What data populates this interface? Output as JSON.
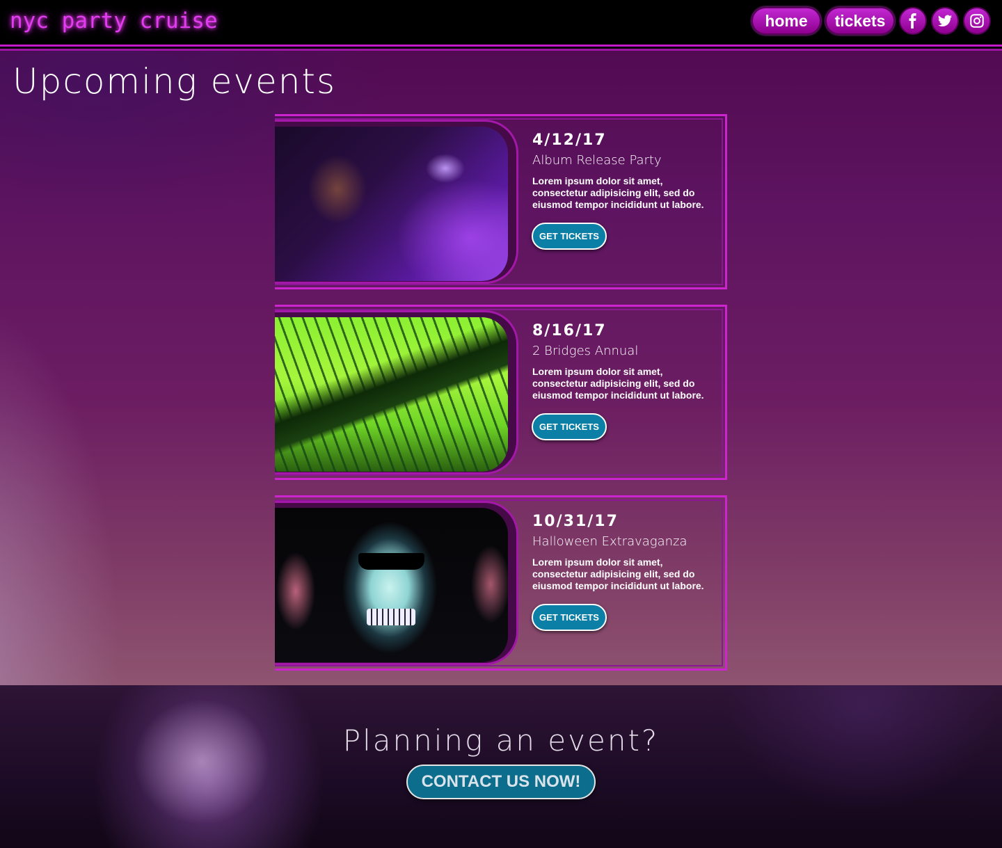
{
  "header": {
    "brand": "nyc party cruise",
    "nav": {
      "home_label": "home",
      "tickets_label": "tickets",
      "social": [
        "facebook-icon",
        "twitter-icon",
        "instagram-icon"
      ]
    }
  },
  "main": {
    "title": "Upcoming events",
    "events": [
      {
        "date": "4/12/17",
        "name": "Album Release Party",
        "description": "Lorem ipsum dolor sit amet, consectetur adipisicing elit, sed do eiusmod tempor incididunt ut labore.",
        "button_label": "GET TICKETS"
      },
      {
        "date": "8/16/17",
        "name": "2 Bridges Annual",
        "description": "Lorem ipsum dolor sit amet, consectetur adipisicing elit, sed do eiusmod tempor incididunt ut labore.",
        "button_label": "GET TICKETS"
      },
      {
        "date": "10/31/17",
        "name": "Halloween Extravaganza",
        "description": "Lorem ipsum dolor sit amet, consectetur adipisicing elit, sed do eiusmod tempor incididunt ut labore.",
        "button_label": "GET TICKETS"
      }
    ]
  },
  "footer": {
    "title": "Planning an event?",
    "contact_label": "CONTACT US NOW!"
  },
  "colors": {
    "accent": "#c419c9",
    "button_blue": "#0b7fa6",
    "brand_glow": "#e23cf0"
  }
}
